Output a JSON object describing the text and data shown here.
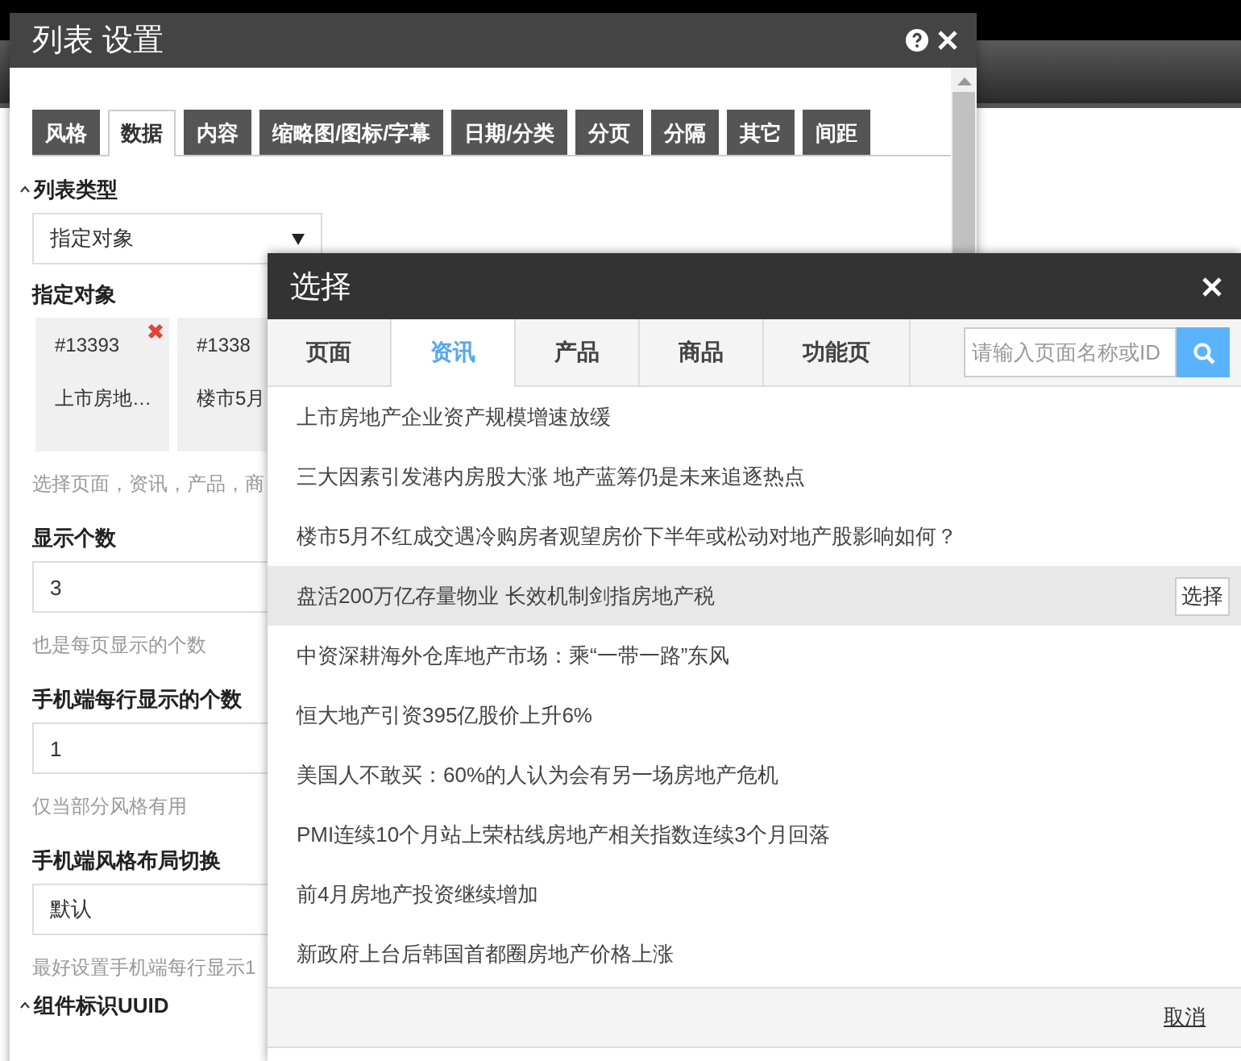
{
  "settings_dialog": {
    "title": "列表 设置",
    "tabs": [
      {
        "label": "风格",
        "selected": false
      },
      {
        "label": "数据",
        "selected": true
      },
      {
        "label": "内容",
        "selected": false
      },
      {
        "label": "缩略图/图标/字幕",
        "selected": false
      },
      {
        "label": "日期/分类",
        "selected": false
      },
      {
        "label": "分页",
        "selected": false
      },
      {
        "label": "分隔",
        "selected": false
      },
      {
        "label": "其它",
        "selected": false
      },
      {
        "label": "间距",
        "selected": false
      }
    ],
    "fields": [
      {
        "kind": "section",
        "label": "列表类型"
      },
      {
        "kind": "select",
        "value": "指定对象"
      },
      {
        "kind": "label",
        "label": "指定对象"
      },
      {
        "kind": "targets",
        "items": [
          {
            "id": "#13393",
            "name": "上市房地…"
          },
          {
            "id": "#1338",
            "name": "楼市5月"
          }
        ]
      },
      {
        "kind": "hint",
        "label": "选择页面，资讯，产品，商"
      },
      {
        "kind": "label",
        "label": "显示个数"
      },
      {
        "kind": "input",
        "value": "3"
      },
      {
        "kind": "hint",
        "label": "也是每页显示的个数"
      },
      {
        "kind": "label",
        "label": "手机端每行显示的个数"
      },
      {
        "kind": "input",
        "value": "1"
      },
      {
        "kind": "hint",
        "label": "仅当部分风格有用"
      },
      {
        "kind": "label",
        "label": "手机端风格布局切换"
      },
      {
        "kind": "input",
        "value": "默认"
      },
      {
        "kind": "hint",
        "label": "最好设置手机端每行显示1"
      },
      {
        "kind": "section",
        "label": "组件标识UUID"
      }
    ]
  },
  "select_dialog": {
    "title": "选择",
    "tabs": [
      {
        "label": "页面",
        "selected": false
      },
      {
        "label": "资讯",
        "selected": true
      },
      {
        "label": "产品",
        "selected": false
      },
      {
        "label": "商品",
        "selected": false
      },
      {
        "label": "功能页",
        "selected": false
      }
    ],
    "search": {
      "placeholder": "请输入页面名称或ID"
    },
    "rows": [
      {
        "title": "上市房地产企业资产规模增速放缓",
        "selected": false
      },
      {
        "title": "三大因素引发港内房股大涨 地产蓝筹仍是未来追逐热点",
        "selected": false
      },
      {
        "title": "楼市5月不红成交遇冷购房者观望房价下半年或松动对地产股影响如何？",
        "selected": false
      },
      {
        "title": "盘活200万亿存量物业 长效机制剑指房地产税",
        "selected": true
      },
      {
        "title": "中资深耕海外仓库地产市场：乘“一带一路”东风",
        "selected": false
      },
      {
        "title": "恒大地产引资395亿股价上升6%",
        "selected": false
      },
      {
        "title": "美国人不敢买：60%的人认为会有另一场房地产危机",
        "selected": false
      },
      {
        "title": "PMI连续10个月站上荣枯线房地产相关指数连续3个月回落",
        "selected": false
      },
      {
        "title": "前4月房地产投资继续增加",
        "selected": false
      },
      {
        "title": "新政府上台后韩国首都圈房地产价格上涨",
        "selected": false
      }
    ],
    "select_button": "选择",
    "cancel": "取消"
  }
}
